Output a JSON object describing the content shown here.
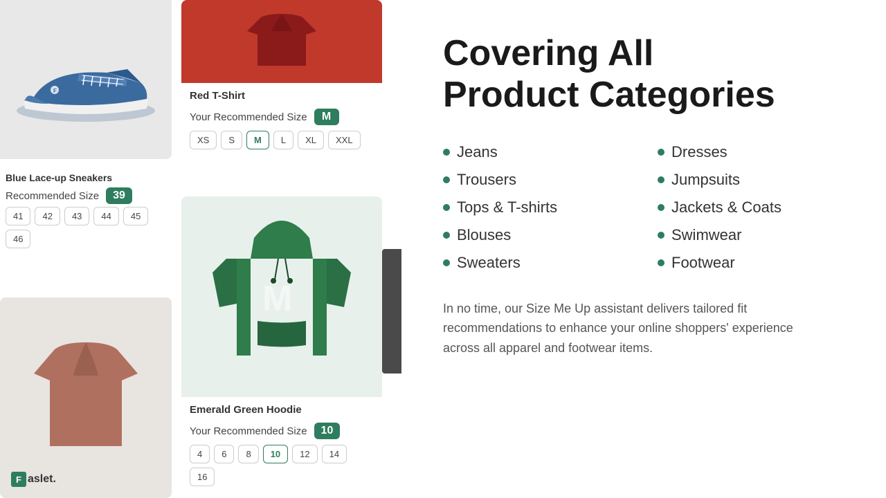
{
  "left": {
    "tshirt_product": {
      "name": "Red T-Shirt",
      "recommended_label": "Your Recommended Size",
      "recommended_size": "M",
      "sizes": [
        "XS",
        "S",
        "M",
        "L",
        "XL",
        "XXL"
      ]
    },
    "sneaker_product": {
      "name": "Blue Lace-up Sneakers",
      "recommended_label": "Recommended Size",
      "recommended_size": "39",
      "sizes": [
        "41",
        "42",
        "43",
        "44",
        "45",
        "46"
      ]
    },
    "hoodie_product": {
      "name": "Emerald Green Hoodie",
      "recommended_label": "Your Recommended Size",
      "recommended_size": "10",
      "sizes": [
        "4",
        "6",
        "8",
        "10",
        "12",
        "14",
        "16"
      ]
    }
  },
  "right": {
    "title_line1": "Covering All",
    "title_line2": "Product Categories",
    "categories_left": [
      "Jeans",
      "Trousers",
      "Tops & T-shirts",
      "Blouses",
      "Sweaters"
    ],
    "categories_right": [
      "Dresses",
      "Jumpsuits",
      "Jackets & Coats",
      "Swimwear",
      "Footwear"
    ],
    "description": "In no time, our Size Me Up assistant delivers tailored fit recommendations to enhance your online shoppers' experience across all apparel and footwear items."
  },
  "logo": {
    "icon": "F",
    "text": "aslet."
  }
}
